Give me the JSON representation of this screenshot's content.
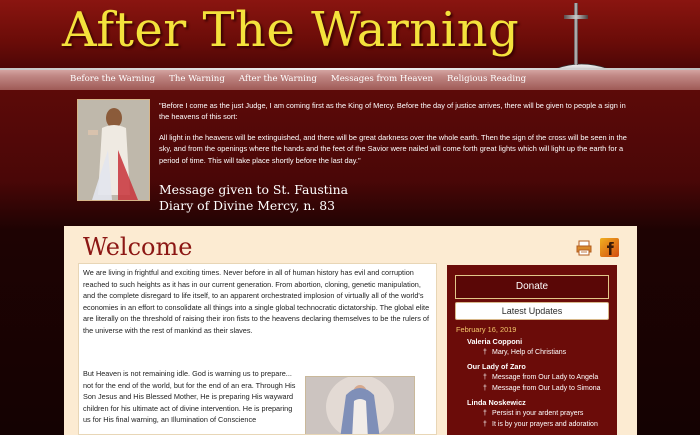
{
  "site": {
    "title": "After The Warning"
  },
  "nav": [
    "Before the Warning",
    "The Warning",
    "After the Warning",
    "Messages from Heaven",
    "Religious Reading"
  ],
  "quote": {
    "paragraphs": [
      "\"Before I come as the just Judge, I am coming first as the King of Mercy. Before the day of justice arrives, there will be given to people a sign in the heavens of this sort:",
      "All light in the heavens will be extinguished, and there will be great darkness over the whole earth. Then the sign of the cross will be seen in the sky, and from the openings where the hands and the feet of the Savior were nailed will come forth great lights which will light up the earth for a period of time. This will take place shortly before the last day.\""
    ],
    "signature_line1": "Message given to St. Faustina",
    "signature_line2": "Diary of Divine Mercy, n. 83"
  },
  "main": {
    "heading": "Welcome",
    "paragraph1": "We are living in frightful and exciting times. Never before in all of human history has evil and corruption reached to such heights as it has in our current generation. From abortion, cloning, genetic manipulation, and the complete disregard to life itself, to an apparent orchestrated implosion of virtually all of the world's economies in an effort to consolidate all things into a single global technocratic dictatorship. The global elite are literally on the threshold of raising their iron fists to the heavens declaring themselves to be the rulers of the universe with the rest of mankind as their slaves.",
    "paragraph2": "But Heaven is not remaining idle. God is warning us to prepare... not for the end of the world, but for the end of an era. Through His Son Jesus and His Blessed Mother, He is preparing His wayward children for his ultimate act of divine intervention. He is preparing us for His final warning, an Illumination of Conscience"
  },
  "sidebar": {
    "donate_label": "Donate",
    "updates_label": "Latest Updates",
    "date": "February 16, 2019",
    "groups": [
      {
        "title": "Valeria Copponi",
        "items": [
          "Mary, Help of Christians"
        ]
      },
      {
        "title": "Our Lady of Zaro",
        "items": [
          "Message from Our Lady to Angela",
          "Message from Our Lady to Simona"
        ]
      },
      {
        "title": "Linda Noskewicz",
        "items": [
          "Persist in your ardent prayers",
          "It is by your prayers and adoration"
        ]
      }
    ]
  },
  "colors": {
    "title_yellow": "#f4e23c",
    "heading_red": "#8c1714",
    "panel_cream": "#fcebd2",
    "sidebar_red": "#6b0c09",
    "date_gold": "#f3c66b"
  },
  "icons": [
    "cross-icon",
    "print-icon",
    "facebook-icon"
  ]
}
